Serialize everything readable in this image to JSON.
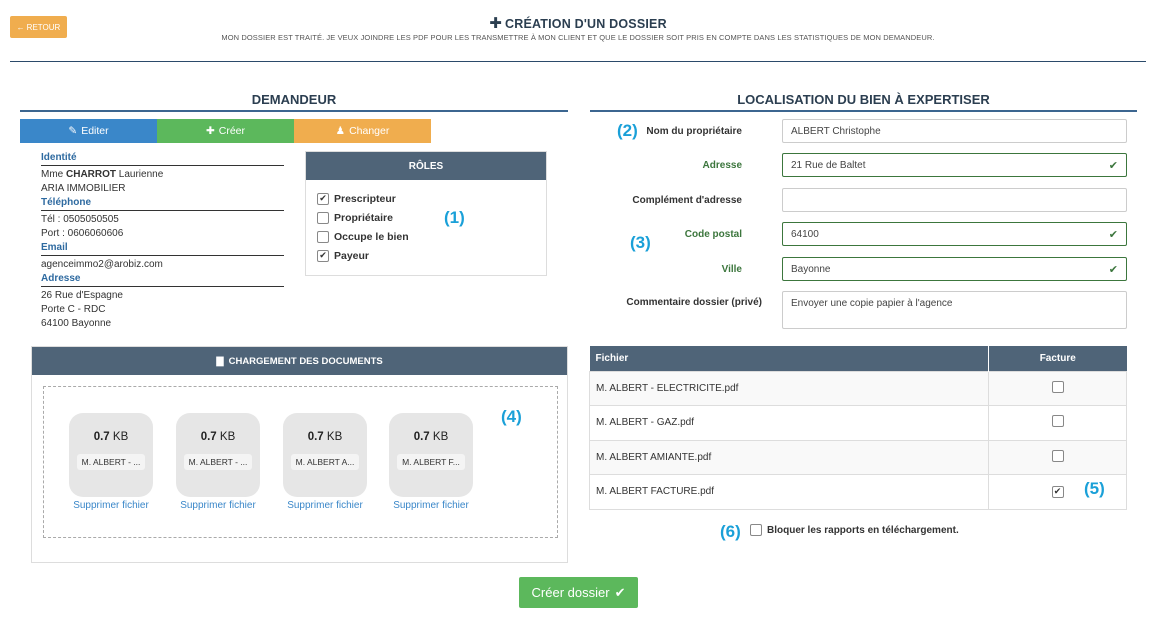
{
  "header": {
    "back_label": "RETOUR",
    "title": "CRÉATION D'UN DOSSIER",
    "subtitle": "MON DOSSIER EST TRAITÉ. JE VEUX JOINDRE LES PDF POUR LES TRANSMETTRE À MON CLIENT ET QUE LE DOSSIER SOIT PRIS EN COMPTE DANS LES STATISTIQUES DE MON DEMANDEUR."
  },
  "demandeur": {
    "title": "DEMANDEUR",
    "buttons": {
      "edit": "Editer",
      "create": "Créer",
      "change": "Changer"
    },
    "identity_label": "Identité",
    "civility": "Mme",
    "last_name": "CHARROT",
    "first_name": "Laurienne",
    "company": "ARIA IMMOBILIER",
    "phone_label": "Téléphone",
    "tel": "Tél : 0505050505",
    "mobile": "Port : 0606060606",
    "email_label": "Email",
    "email": "agenceimmo2@arobiz.com",
    "address_label": "Adresse",
    "address_line1": "26 Rue d'Espagne",
    "address_line2": "Porte C - RDC",
    "address_line3": "64100 Bayonne"
  },
  "roles": {
    "title": "RÔLES",
    "items": [
      {
        "label": "Prescripteur",
        "checked": true
      },
      {
        "label": "Propriétaire",
        "checked": false
      },
      {
        "label": "Occupe le bien",
        "checked": false
      },
      {
        "label": "Payeur",
        "checked": true
      }
    ]
  },
  "markers": {
    "m1": "(1)",
    "m2": "(2)",
    "m3": "(3)",
    "m4": "(4)",
    "m5": "(5)",
    "m6": "(6)"
  },
  "upload": {
    "title": "CHARGEMENT DES DOCUMENTS",
    "files": [
      {
        "size_value": "0.7",
        "size_unit": "KB",
        "name": "M. ALBERT - ...",
        "delete_label": "Supprimer fichier"
      },
      {
        "size_value": "0.7",
        "size_unit": "KB",
        "name": "M. ALBERT - ...",
        "delete_label": "Supprimer fichier"
      },
      {
        "size_value": "0.7",
        "size_unit": "KB",
        "name": "M. ALBERT A...",
        "delete_label": "Supprimer fichier"
      },
      {
        "size_value": "0.7",
        "size_unit": "KB",
        "name": "M. ALBERT F...",
        "delete_label": "Supprimer fichier"
      }
    ]
  },
  "localisation": {
    "title": "LOCALISATION DU BIEN À EXPERTISER",
    "owner_label": "Nom du propriétaire",
    "owner_value": "ALBERT Christophe",
    "address_label": "Adresse",
    "address_value": "21 Rue de Baltet",
    "address_complement_label": "Complément d'adresse",
    "address_complement_value": "",
    "postal_code_label": "Code postal",
    "postal_code_value": "64100",
    "city_label": "Ville",
    "city_value": "Bayonne",
    "comment_label": "Commentaire dossier (privé)",
    "comment_value": "Envoyer une copie papier à l'agence"
  },
  "files_table": {
    "col_file": "Fichier",
    "col_invoice": "Facture",
    "rows": [
      {
        "name": "M. ALBERT - ELECTRICITE.pdf",
        "invoice": false
      },
      {
        "name": "M. ALBERT - GAZ.pdf",
        "invoice": false
      },
      {
        "name": "M. ALBERT AMIANTE.pdf",
        "invoice": false
      },
      {
        "name": "M. ALBERT FACTURE.pdf",
        "invoice": true
      }
    ]
  },
  "block_reports_label": "Bloquer les rapports en téléchargement.",
  "create_button_label": "Créer dossier",
  "colors": {
    "primary": "#3a87c9",
    "success": "#5cb85c",
    "warning": "#f0ad4e",
    "panel_header": "#4f6478",
    "marker": "#1aa0d8"
  }
}
